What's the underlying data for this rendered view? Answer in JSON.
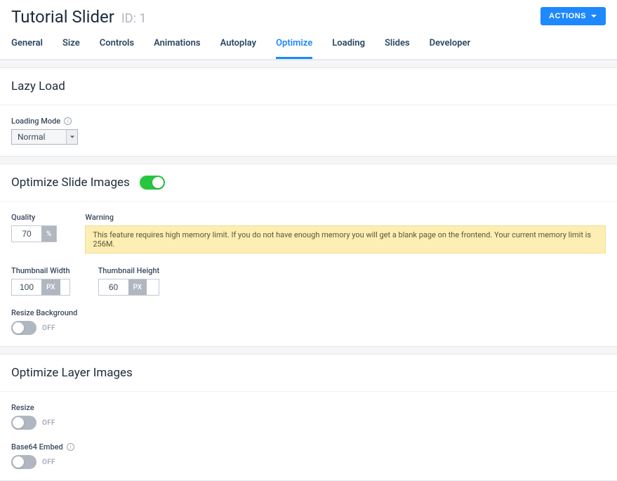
{
  "header": {
    "title": "Tutorial Slider",
    "id_label": "ID: 1",
    "actions_label": "ACTIONS"
  },
  "tabs": [
    {
      "label": "General"
    },
    {
      "label": "Size"
    },
    {
      "label": "Controls"
    },
    {
      "label": "Animations"
    },
    {
      "label": "Autoplay"
    },
    {
      "label": "Optimize",
      "active": true
    },
    {
      "label": "Loading"
    },
    {
      "label": "Slides"
    },
    {
      "label": "Developer"
    }
  ],
  "lazy_load": {
    "title": "Lazy Load",
    "mode_label": "Loading Mode",
    "mode_value": "Normal"
  },
  "optimize_slide": {
    "title": "Optimize Slide Images",
    "enabled": true,
    "quality_label": "Quality",
    "quality_value": "70",
    "quality_unit": "%",
    "warning_label": "Warning",
    "warning_text": "This feature requires high memory limit. If you do not have enough memory you will get a blank page on the frontend. Your current memory limit is 256M.",
    "thumb_w_label": "Thumbnail Width",
    "thumb_w_value": "100",
    "thumb_h_label": "Thumbnail Height",
    "thumb_h_value": "60",
    "px_unit": "PX",
    "resize_bg_label": "Resize Background",
    "resize_bg_state": "OFF"
  },
  "optimize_layer": {
    "title": "Optimize Layer Images",
    "resize_label": "Resize",
    "resize_state": "OFF",
    "base64_label": "Base64 Embed",
    "base64_state": "OFF"
  }
}
